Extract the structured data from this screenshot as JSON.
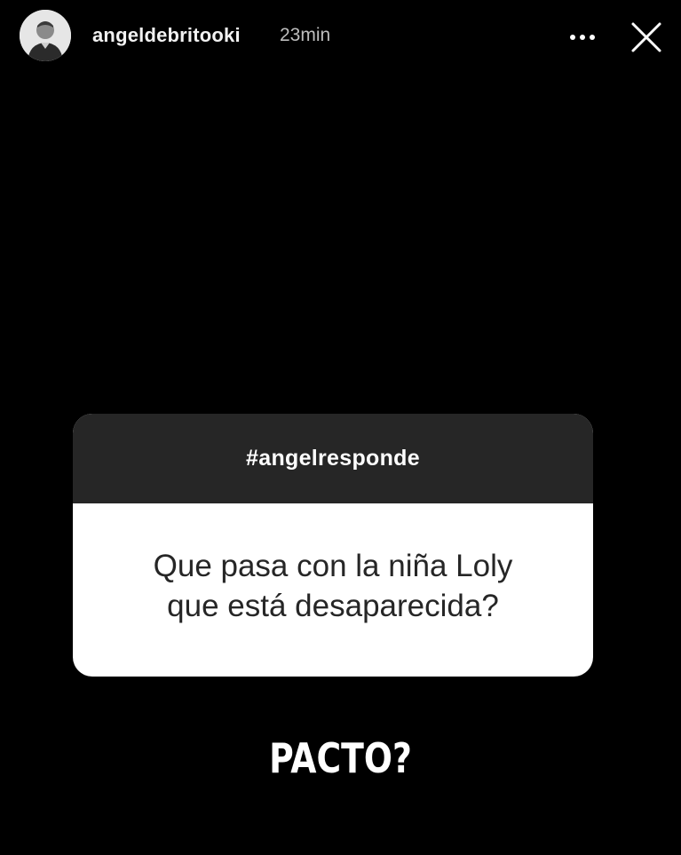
{
  "header": {
    "username": "angeldebritooki",
    "timestamp": "23min",
    "avatar_icon": "profile-photo",
    "more_icon": "more-horizontal-icon",
    "close_icon": "close-icon"
  },
  "question_sticker": {
    "tag": "#angelresponde",
    "question_lines": [
      "Que pasa con la niña Loly",
      "que está desaparecida?"
    ]
  },
  "caption": "PACTO?",
  "colors": {
    "background": "#000000",
    "sticker_header": "#262626",
    "sticker_body": "#ffffff",
    "question_text": "#262626"
  }
}
